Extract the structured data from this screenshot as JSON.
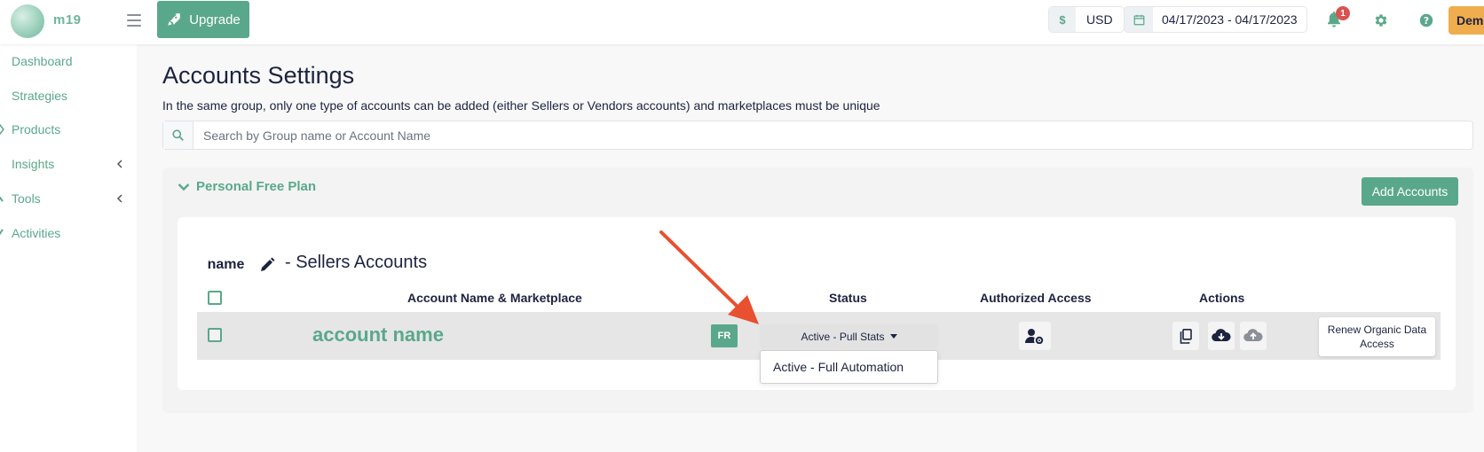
{
  "app": {
    "logo_text": "m19"
  },
  "header": {
    "upgrade_label": "Upgrade",
    "currency_symbol": "$",
    "currency_value": "USD",
    "date_range": "04/17/2023 - 04/17/2023",
    "notification_count": "1",
    "demo_label": "Demo"
  },
  "sidebar": {
    "items": [
      {
        "label": "Dashboard",
        "icon": "dashboard-icon"
      },
      {
        "label": "Strategies",
        "icon": "strategies-icon"
      },
      {
        "label": "Products",
        "icon": "tag-icon"
      },
      {
        "label": "Insights",
        "icon": "insights-icon",
        "expandable": true
      },
      {
        "label": "Tools",
        "icon": "wrench-icon",
        "expandable": true
      },
      {
        "label": "Activities",
        "icon": "activities-icon"
      }
    ]
  },
  "main": {
    "title": "Accounts Settings",
    "description": "In the same group, only one type of accounts can be added (either Sellers or Vendors accounts) and marketplaces must be unique",
    "search_placeholder": "Search by Group name or Account Name",
    "plan": {
      "name": "Personal Free Plan",
      "add_accounts_label": "Add Accounts",
      "group": {
        "name": "name",
        "type_label": "- Sellers Accounts",
        "columns": {
          "account": "Account Name & Marketplace",
          "status": "Status",
          "authorized": "Authorized Access",
          "actions": "Actions"
        },
        "rows": [
          {
            "account_name": "account name",
            "marketplace": "FR",
            "status": "Active - Pull Stats",
            "status_options": [
              "Active - Full Automation"
            ],
            "renew_label": "Renew Organic Data Access"
          }
        ]
      }
    }
  },
  "colors": {
    "accent": "#5aa88b",
    "text": "#1c2340",
    "notification": "#d9534f",
    "demo": "#f0ad4e",
    "annotation_arrow": "#e8502f"
  }
}
